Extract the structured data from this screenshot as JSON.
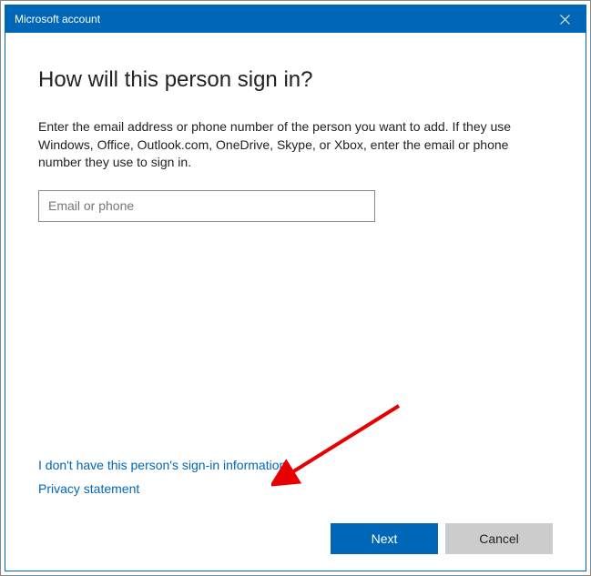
{
  "titlebar": {
    "title": "Microsoft account"
  },
  "main": {
    "heading": "How will this person sign in?",
    "description": "Enter the email address or phone number of the person you want to add. If they use Windows, Office, Outlook.com, OneDrive, Skype, or Xbox, enter the email or phone number they use to sign in.",
    "input_placeholder": "Email or phone",
    "input_value": ""
  },
  "links": {
    "no_signin_info": "I don't have this person's sign-in information",
    "privacy": "Privacy statement"
  },
  "buttons": {
    "next": "Next",
    "cancel": "Cancel"
  }
}
